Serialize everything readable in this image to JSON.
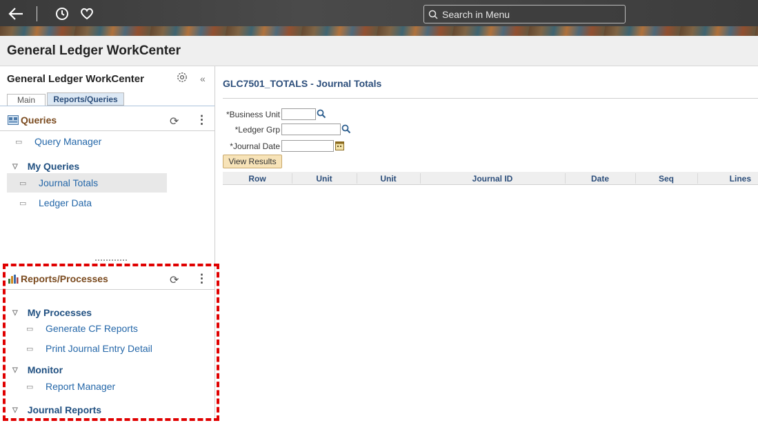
{
  "header": {
    "search_placeholder": "Search in Menu"
  },
  "title_bar": {
    "title": "General Ledger WorkCenter"
  },
  "left_pane": {
    "title": "General Ledger WorkCenter",
    "tabs": [
      {
        "label": "Main"
      },
      {
        "label": "Reports/Queries"
      }
    ],
    "queries": {
      "title": "Queries",
      "query_manager": "Query Manager",
      "group": "My Queries",
      "items": [
        "Journal Totals",
        "Ledger Data"
      ]
    },
    "reports": {
      "title": "Reports/Processes",
      "group_processes": "My Processes",
      "processes": [
        "Generate CF Reports",
        "Print Journal Entry Detail"
      ],
      "group_monitor": "Monitor",
      "monitor_items": [
        "Report Manager"
      ],
      "group_journal": "Journal Reports"
    }
  },
  "content": {
    "title": "GLC7501_TOTALS - Journal Totals",
    "fields": {
      "business_unit": "*Business Unit",
      "ledger_grp": "*Ledger Grp",
      "journal_date": "*Journal Date"
    },
    "button": "View Results",
    "columns": [
      "Row",
      "Unit",
      "Unit",
      "Journal ID",
      "Date",
      "Seq",
      "Lines"
    ]
  }
}
